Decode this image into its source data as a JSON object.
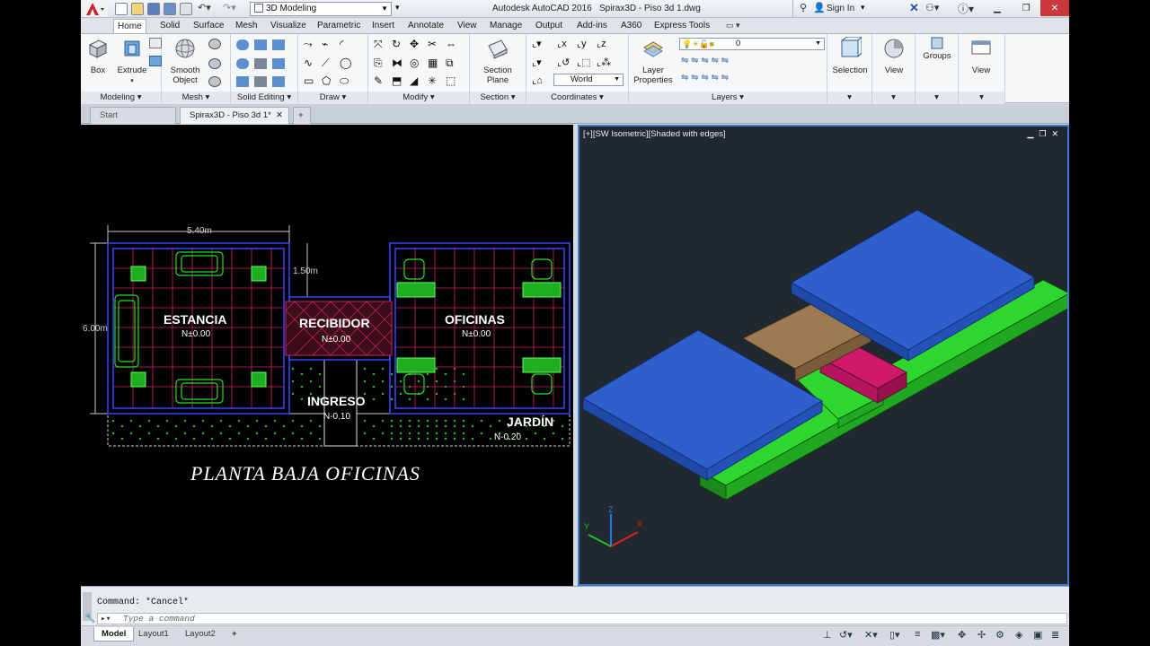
{
  "titlebar": {
    "workspace": "3D Modeling",
    "app_name": "Autodesk AutoCAD 2016",
    "file": "Spirax3D - Piso 3d 1.dwg",
    "signin": "Sign In",
    "menu_icon": "autocad-a-icon"
  },
  "ribbon_tabs": [
    "Home",
    "Solid",
    "Surface",
    "Mesh",
    "Visualize",
    "Parametric",
    "Insert",
    "Annotate",
    "View",
    "Manage",
    "Output",
    "Add-ins",
    "A360",
    "Express Tools"
  ],
  "ribbon": {
    "modeling": {
      "title": "Modeling",
      "box": "Box",
      "extrude": "Extrude"
    },
    "mesh": {
      "title": "Mesh",
      "smooth_object_1": "Smooth",
      "smooth_object_2": "Object"
    },
    "solid_editing": {
      "title": "Solid Editing"
    },
    "draw": {
      "title": "Draw"
    },
    "modify": {
      "title": "Modify"
    },
    "section": {
      "title": "Section",
      "section_plane_1": "Section",
      "section_plane_2": "Plane"
    },
    "coordinates": {
      "title": "Coordinates",
      "ucs": "World"
    },
    "layers": {
      "title": "Layers",
      "layer_properties_1": "Layer",
      "layer_properties_2": "Properties",
      "current_layer": "0"
    },
    "selection": {
      "label": "Selection"
    },
    "view": {
      "label": "View"
    },
    "groups": {
      "label": "Groups"
    },
    "view2": {
      "label": "View"
    }
  },
  "file_tabs": {
    "start": "Start",
    "active": "Spirax3D - Piso 3d 1*"
  },
  "viewport_left": {
    "dim_width": "5.40m",
    "dim_height": "6.00m",
    "dim_setback": "1.50m",
    "rooms": [
      {
        "name": "ESTANCIA",
        "level": "N±0.00"
      },
      {
        "name": "RECIBIDOR",
        "level": "N±0.00"
      },
      {
        "name": "OFICINAS",
        "level": "N±0.00"
      },
      {
        "name": "INGRESO",
        "level": "N-0.10"
      },
      {
        "name": "JARDÍN",
        "level": "N-0.20"
      }
    ],
    "drawing_title": "PLANTA BAJA OFICINAS"
  },
  "viewport_right": {
    "label": "[+][SW Isometric][Shaded with edges]",
    "colors": {
      "blue": "#2f5fcc",
      "green": "#22b422",
      "brown": "#8c6a45",
      "magenta": "#b5155f"
    }
  },
  "command": {
    "history": "Command: *Cancel*",
    "placeholder": "Type a command"
  },
  "layout_tabs": [
    "Model",
    "Layout1",
    "Layout2"
  ]
}
